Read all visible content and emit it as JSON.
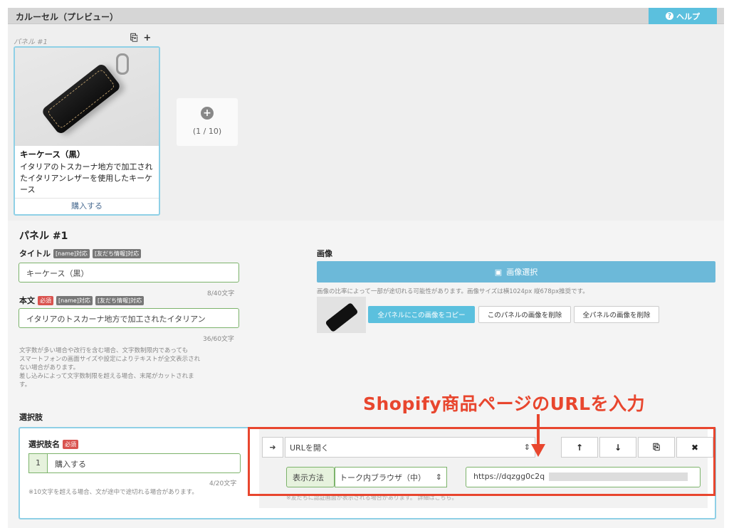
{
  "header": {
    "title": "カルーセル（プレビュー）",
    "help_label": "ヘルプ"
  },
  "preview": {
    "panel_label": "パネル #1",
    "card": {
      "title": "キーケース（黒）",
      "text": "イタリアのトスカーナ地方で加工されたイタリアンレザーを使用したキーケース",
      "link": "購入する"
    },
    "add_count": "(1 / 10)"
  },
  "edit": {
    "panel_title": "パネル #1",
    "title_label": "タイトル",
    "tag_name": "[name]対応",
    "tag_friend": "[友だち情報]対応",
    "tag_required": "必須",
    "title_value": "キーケース（黒）",
    "title_counter": "8/40文字",
    "body_label": "本文",
    "body_value": "イタリアのトスカーナ地方で加工されたイタリアン",
    "body_counter": "36/60文字",
    "note_lines": [
      "文字数が多い場合や改行を含む場合、文字数制限内であっても",
      "スマートフォンの画面サイズや設定によりテキストが全文表示され",
      "ない場合があります。",
      "差し込みによって文字数制限を超える場合、末尾がカットされま",
      "す。"
    ],
    "image_label": "画像",
    "image_button": "画像選択",
    "image_note": "画像の比率によって一部が途切れる可能性があります。画像サイズは横1024px 縦678px推奨です。",
    "copy_all_button": "全パネルにこの画像をコピー",
    "delete_this_button": "このパネルの画像を削除",
    "delete_all_button": "全パネルの画像を削除"
  },
  "choices": {
    "section_label": "選択肢",
    "name_label": "選択肢名",
    "index": "1",
    "name_value": "購入する",
    "name_counter": "4/20文字",
    "name_note": "※10文字を超える場合、文が途中で途切れる場合があります。",
    "action_select": "URLを開く",
    "display_label": "表示方法",
    "display_select": "トーク内ブラウザ（中）",
    "url_value": "https://dqzgg0c2q",
    "hidden_note": "※友だちに認証画面が表示される場合があります。 詳細はこちら。"
  },
  "annotation": "Shopify商品ページのURLを入力",
  "colors": {
    "accent": "#5bc0de",
    "annotation": "#e8462e",
    "field_border": "#7cb36b"
  }
}
